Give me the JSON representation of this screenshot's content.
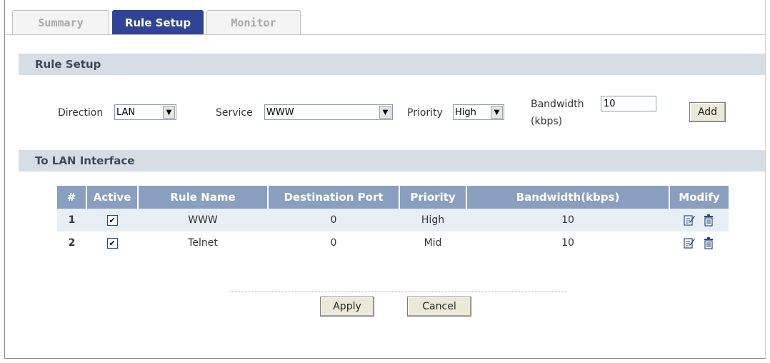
{
  "tabs": [
    {
      "label": "Summary"
    },
    {
      "label": "Rule Setup"
    },
    {
      "label": "Monitor"
    }
  ],
  "rule_setup": {
    "section_title": "Rule Setup",
    "direction_label": "Direction",
    "direction_value": "LAN",
    "service_label": "Service",
    "service_value": "WWW",
    "priority_label": "Priority",
    "priority_value": "High",
    "bandwidth_label_line1": "Bandwidth",
    "bandwidth_label_line2": "(kbps)",
    "bandwidth_value": "10",
    "add_label": "Add"
  },
  "interface": {
    "section_title": "To LAN Interface",
    "columns": [
      "#",
      "Active",
      "Rule Name",
      "Destination Port",
      "Priority",
      "Bandwidth(kbps)",
      "Modify"
    ],
    "rows": [
      {
        "num": "1",
        "active": true,
        "name": "WWW",
        "port": "0",
        "priority": "High",
        "bandwidth": "10"
      },
      {
        "num": "2",
        "active": true,
        "name": "Telnet",
        "port": "0",
        "priority": "Mid",
        "bandwidth": "10"
      }
    ]
  },
  "footer": {
    "apply_label": "Apply",
    "cancel_label": "Cancel"
  },
  "icons": {
    "edit": "edit-icon",
    "delete": "trash-icon"
  },
  "colors": {
    "active_tab": "#2f4496",
    "section_bar": "#d7dde5",
    "table_header": "#8a9fbf",
    "row_alt": "#e8eef6"
  }
}
